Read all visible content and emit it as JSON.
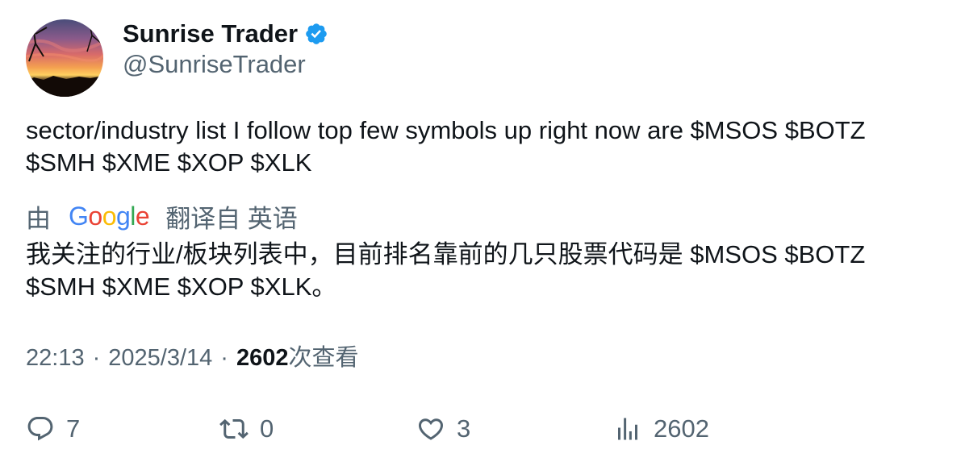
{
  "author": {
    "display_name": "Sunrise Trader",
    "handle": "@SunriseTrader",
    "verified": true,
    "verified_color": "#1d9bf0"
  },
  "tweet": {
    "text_lines": [
      "sector/industry list I follow top few symbols up right now are $MSOS $BOTZ",
      "$SMH $XME $XOP $XLK"
    ]
  },
  "translation": {
    "prefix": "由",
    "provider_letters": [
      "G",
      "o",
      "o",
      "g",
      "l",
      "e"
    ],
    "provider_colors": [
      "#4285f4",
      "#ea4335",
      "#fbbc05",
      "#4285f4",
      "#34a853",
      "#ea4335"
    ],
    "suffix": "翻译自 英语",
    "text_lines": [
      "我关注的行业/板块列表中，目前排名靠前的几只股票代码是 $MSOS $BOTZ",
      "$SMH $XME $XOP $XLK。"
    ]
  },
  "meta": {
    "time": "22:13",
    "separator": "·",
    "date": "2025/3/14",
    "views_count": "2602",
    "views_label": "次查看"
  },
  "actions": {
    "reply": {
      "icon": "reply-icon",
      "count": "7"
    },
    "retweet": {
      "icon": "retweet-icon",
      "count": "0"
    },
    "like": {
      "icon": "heart-icon",
      "count": "3"
    },
    "views": {
      "icon": "views-chart-icon",
      "count": "2602"
    }
  },
  "colors": {
    "text_primary": "#0f1419",
    "text_secondary": "#536471"
  }
}
